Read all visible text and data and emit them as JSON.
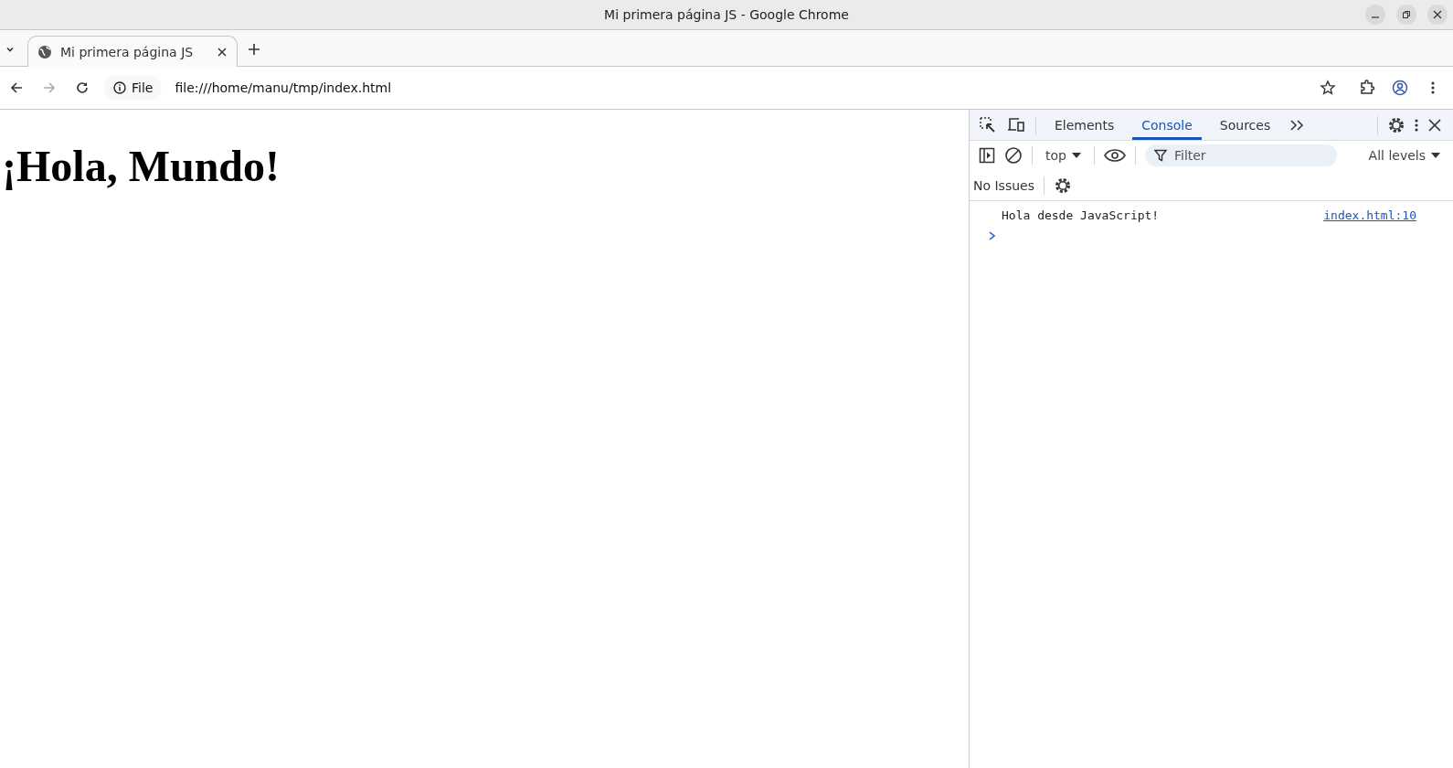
{
  "window": {
    "title": "Mi primera página JS - Google Chrome"
  },
  "browser_tabs": [
    {
      "title": "Mi primera página JS",
      "selected": true
    }
  ],
  "toolbar": {
    "forward_disabled": true
  },
  "address_bar": {
    "scheme_label": "File",
    "url": "file:///home/manu/tmp/index.html"
  },
  "page": {
    "heading": "¡Hola, Mundo!"
  },
  "devtools": {
    "tabs": [
      {
        "label": "Elements",
        "selected": false
      },
      {
        "label": "Console",
        "selected": true
      },
      {
        "label": "Sources",
        "selected": false
      }
    ],
    "context": "top",
    "filter": {
      "placeholder": "Filter"
    },
    "levels": "All levels",
    "issues": "No Issues",
    "messages": [
      {
        "text": "Hola desde JavaScript!",
        "source": "index.html:10"
      }
    ]
  }
}
